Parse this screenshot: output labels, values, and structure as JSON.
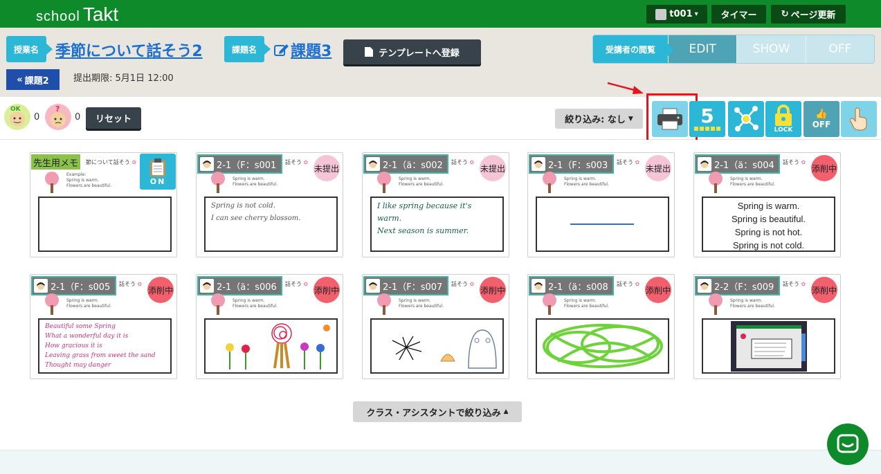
{
  "header": {
    "logo_school": "school",
    "logo_takt": "Takt",
    "user": "t001",
    "timer": "タイマー",
    "refresh": "ページ更新"
  },
  "lesson": {
    "lesson_tag": "授業名",
    "lesson_title": "季節について話そう2",
    "task_tag": "課題名",
    "task_title": "課題3",
    "template_btn": "テンプレートへ登録",
    "back_btn": "課題2",
    "deadline": "提出期限: 5月1日 12:00"
  },
  "view_mode": {
    "label": "受講者の閲覧",
    "options": [
      "EDIT",
      "SHOW",
      "OFF"
    ],
    "active": "EDIT"
  },
  "toolbar": {
    "ok_count": "0",
    "question_count": "0",
    "reset": "リセット",
    "filter": "絞り込み: なし",
    "grid_number": "5",
    "lock_label": "LOCK",
    "off_label": "OFF"
  },
  "teacher_card": {
    "memo": "先生用メモ",
    "excerpt": "節について話そう",
    "example": "Example:",
    "line1": "Spring is warm.",
    "line2": "Flowers are beautiful.",
    "on_label": "ON"
  },
  "students": [
    {
      "name": "2-1（F：s001",
      "excerpt": "話そう",
      "status": "未提出",
      "status_type": "pending",
      "answer": [
        "Spring is not cold.",
        "I can see cherry blossom."
      ],
      "answer_type": "hand"
    },
    {
      "name": "2-1（ä：s002",
      "excerpt": "話そう",
      "status": "未提出",
      "status_type": "pending",
      "answer": [
        "I like spring because it's warm.",
        "Next season is summer."
      ],
      "answer_type": "hand-green"
    },
    {
      "name": "2-1（F：s003",
      "excerpt": "話そう",
      "status": "未提出",
      "status_type": "pending",
      "answer": [],
      "answer_type": "line"
    },
    {
      "name": "2-1（ä：s004",
      "excerpt": "話そう",
      "status": "添削中",
      "status_type": "editing",
      "answer": [
        "Spring is warm.",
        "Spring is beautiful.",
        "Spring is not hot.",
        "Spring is not cold."
      ],
      "answer_type": "typed"
    },
    {
      "name": "2-1（F：s005",
      "excerpt": "話そう",
      "status": "添削中",
      "status_type": "editing",
      "answer": [
        "Beautiful some Spring",
        "What a wonderful day it is",
        "How gracious it is",
        "Leaving grass from sweet the sand",
        "Thought may danger"
      ],
      "answer_type": "hand-pink"
    },
    {
      "name": "2-1（ä：s006",
      "excerpt": "話そう",
      "status": "添削中",
      "status_type": "editing",
      "answer": [],
      "answer_type": "drawing-flowers"
    },
    {
      "name": "2-1（F：s007",
      "excerpt": "話そう",
      "status": "添削中",
      "status_type": "editing",
      "answer": [],
      "answer_type": "drawing-creatures"
    },
    {
      "name": "2-1（ä：s008",
      "excerpt": "話そう",
      "status": "添削中",
      "status_type": "editing",
      "answer": [],
      "answer_type": "drawing-scribble"
    },
    {
      "name": "2-2（F：s009",
      "excerpt": "話そう",
      "status": "添削中",
      "status_type": "editing",
      "answer": [],
      "answer_type": "photo"
    }
  ],
  "card_template": {
    "line1": "Spring is warm.",
    "line2": "Flowers are beautiful."
  },
  "class_filter": "クラス・アシスタントで絞り込み",
  "colors": {
    "brand_green": "#0f8a2a",
    "accent_cyan": "#2db7d6",
    "link_blue": "#1c6fd0",
    "highlight_red": "#e4161b"
  }
}
